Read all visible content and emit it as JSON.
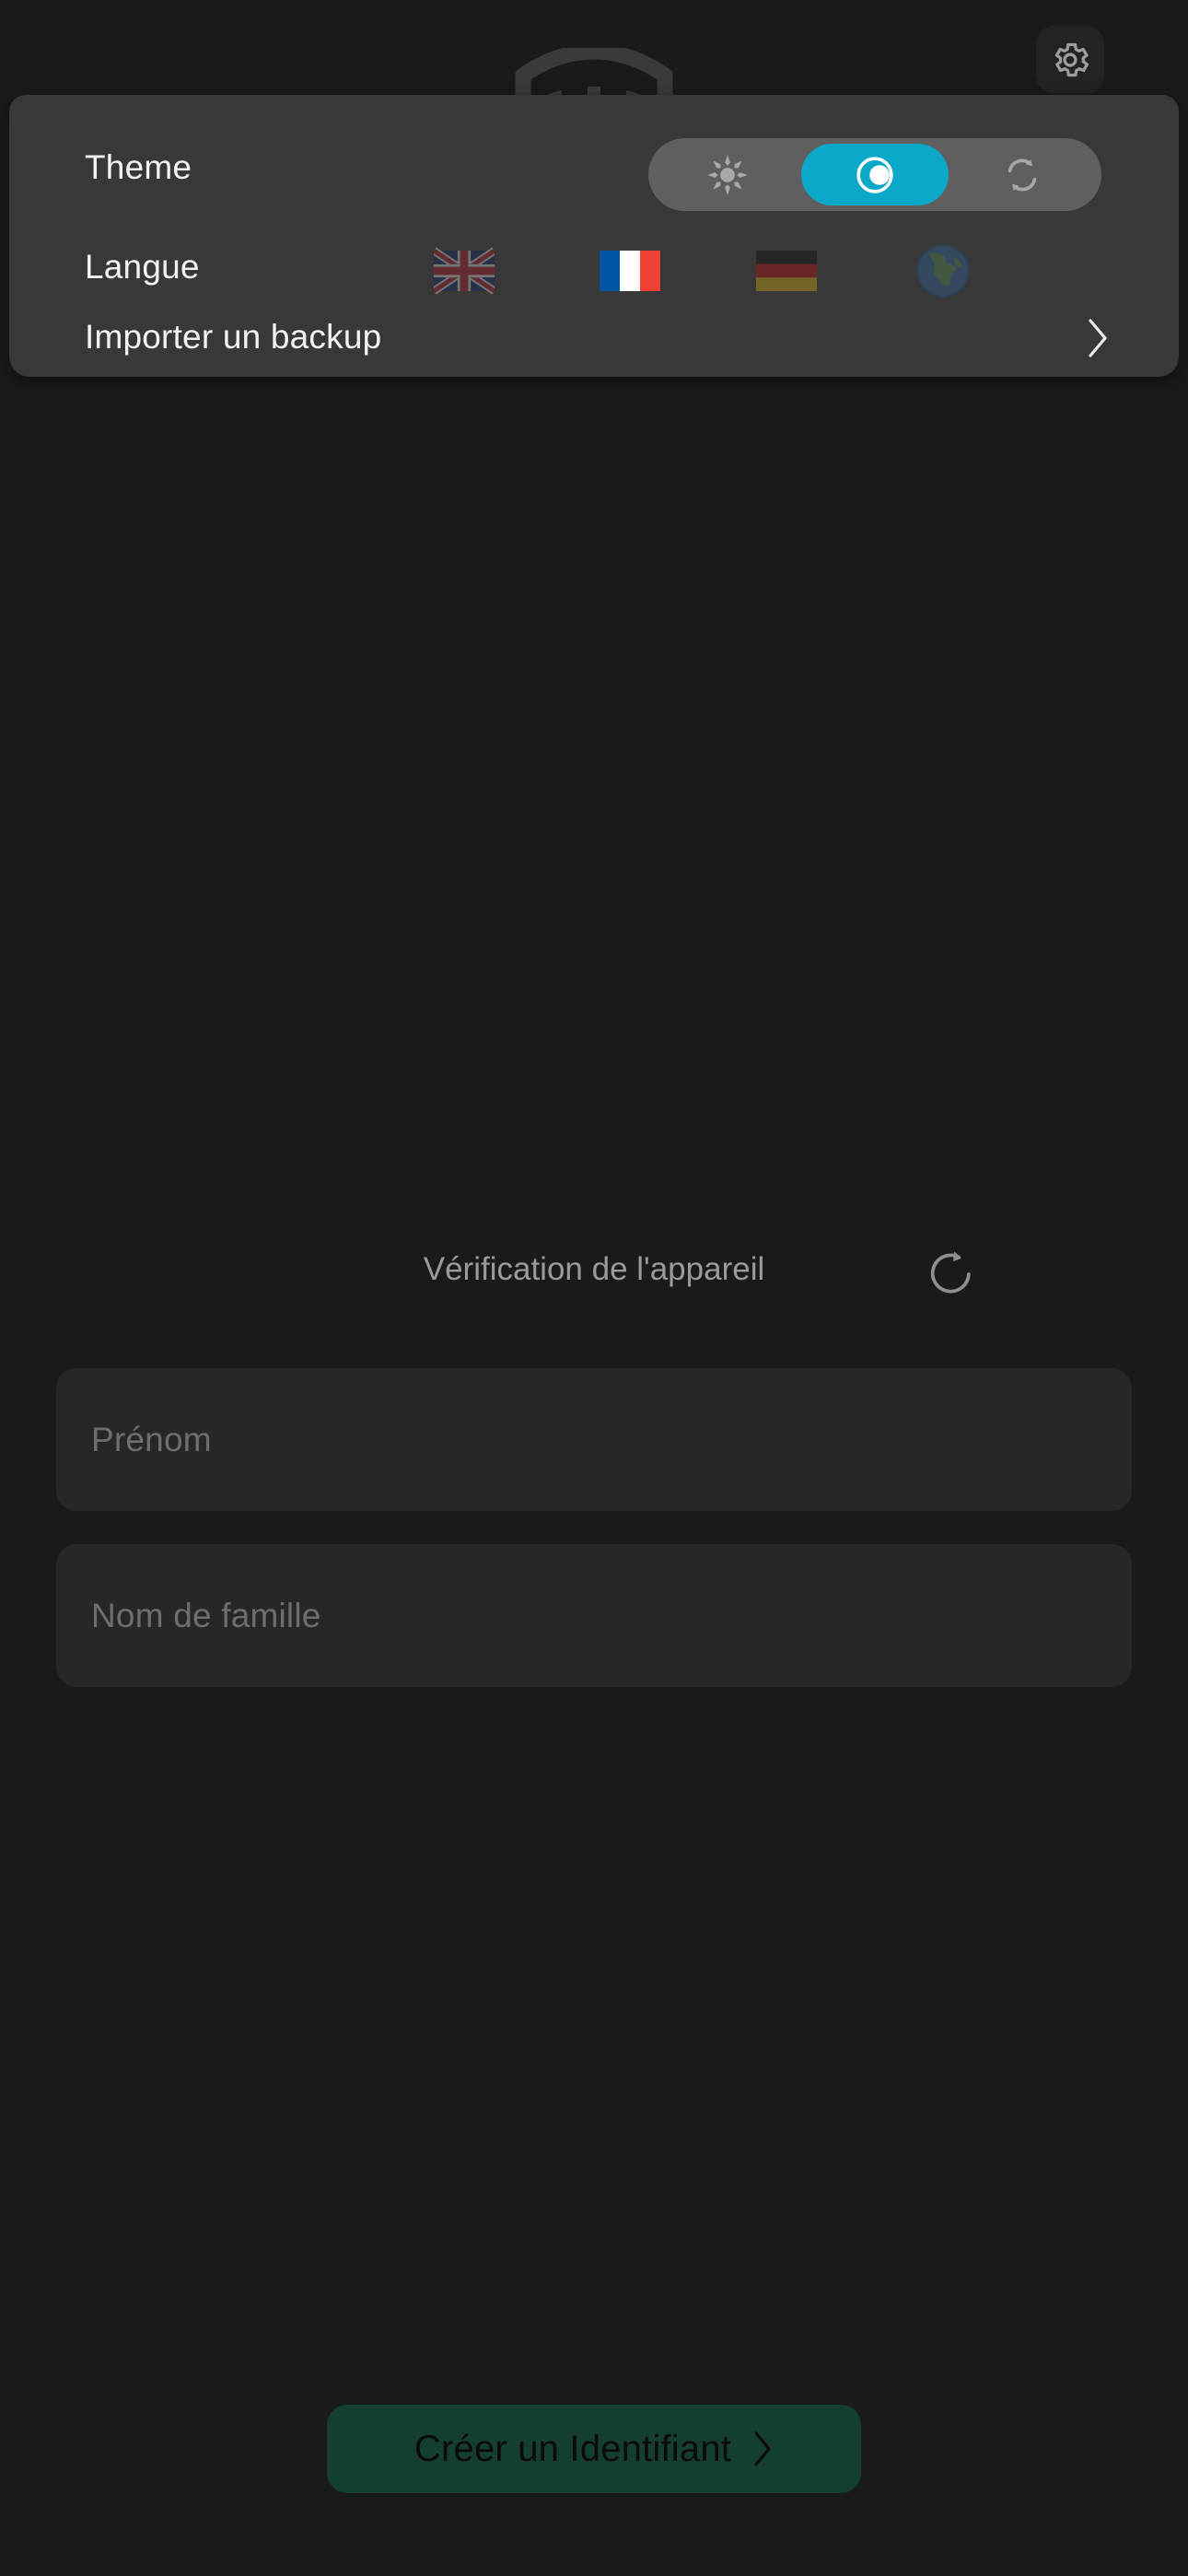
{
  "colors": {
    "background": "#1a1a1a",
    "panel": "#383838",
    "segment_track": "#5f5f5f",
    "accent_cyan": "#0ca8c9",
    "field": "#272727",
    "cta_green": "#143d34",
    "text_primary": "#f2f2f2",
    "text_muted": "#9a9a9a",
    "placeholder": "#6e6e6e"
  },
  "header": {
    "settings_button_icon": "gear-icon",
    "watermark_icon": "app-logo-watermark"
  },
  "settings_panel": {
    "theme": {
      "label": "Theme",
      "options": [
        {
          "id": "light",
          "icon": "sun-icon",
          "selected": false
        },
        {
          "id": "dark",
          "icon": "moon-icon",
          "selected": true
        },
        {
          "id": "auto",
          "icon": "sync-icon",
          "selected": false
        }
      ]
    },
    "language": {
      "label": "Langue",
      "options": [
        {
          "id": "en",
          "icon": "flag-uk-icon",
          "selected": false
        },
        {
          "id": "fr",
          "icon": "flag-france-icon",
          "selected": true
        },
        {
          "id": "de",
          "icon": "flag-germany-icon",
          "selected": false
        },
        {
          "id": "system",
          "icon": "globe-icon",
          "selected": false
        }
      ]
    },
    "import_backup": {
      "label": "Importer un backup",
      "chevron_icon": "chevron-right-icon"
    }
  },
  "verification": {
    "label": "Vérification de l'appareil",
    "refresh_icon": "refresh-icon"
  },
  "form": {
    "first_name": {
      "placeholder": "Prénom",
      "value": ""
    },
    "last_name": {
      "placeholder": "Nom de famille",
      "value": ""
    }
  },
  "cta": {
    "label": "Créer un Identifiant",
    "chevron_icon": "chevron-right-icon"
  }
}
